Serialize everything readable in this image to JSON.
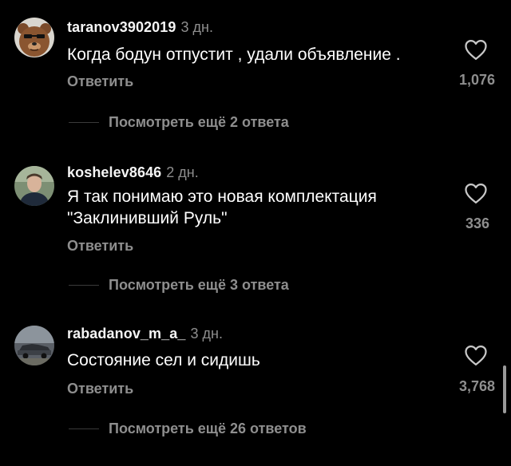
{
  "comments": [
    {
      "username": "taranov3902019",
      "time": "3 дн.",
      "text": "Когда бодун отпустит , удали объявление .",
      "reply_label": "Ответить",
      "likes": "1,076",
      "view_replies": "Посмотреть ещё 2 ответа"
    },
    {
      "username": "koshelev8646",
      "time": "2 дн.",
      "text": "Я так понимаю это новая комплектация \"Заклинивший Руль\"",
      "reply_label": "Ответить",
      "likes": "336",
      "view_replies": "Посмотреть ещё 3 ответа"
    },
    {
      "username": "rabadanov_m_a_",
      "time": "3 дн.",
      "text": "Состояние сел и сидишь",
      "reply_label": "Ответить",
      "likes": "3,768",
      "view_replies": "Посмотреть ещё 26 ответов"
    }
  ],
  "icons": {
    "like": "heart-outline-icon"
  },
  "colors": {
    "background": "#000000",
    "text_primary": "#ffffff",
    "text_secondary": "#8e8e8e"
  }
}
